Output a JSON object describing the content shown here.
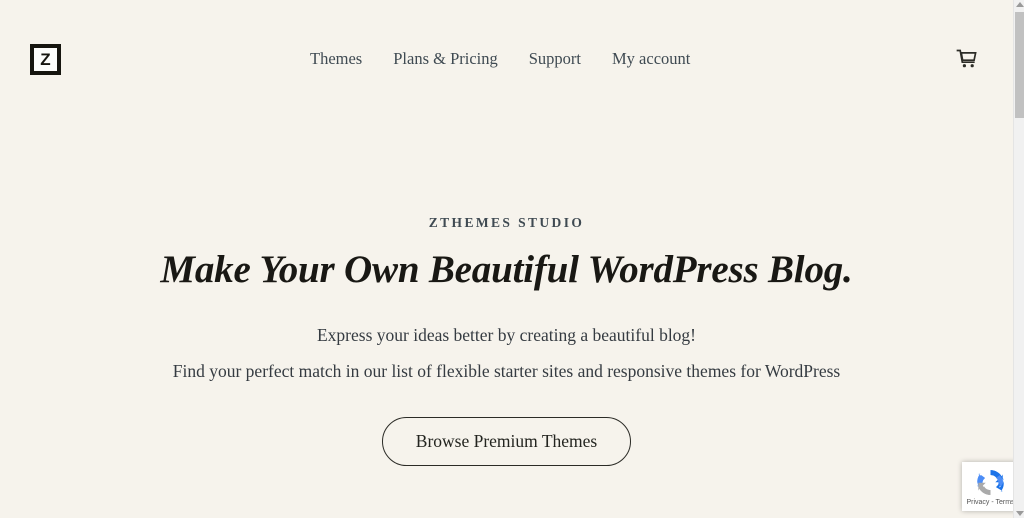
{
  "theme": {
    "background": "#f6f3ec",
    "text_dark": "#191814",
    "text_body": "#353b41",
    "nav_text": "#3f4a52",
    "border_dark": "#2b2b26"
  },
  "header": {
    "logo_letter": "Z",
    "logo_name": "ZThemes Studio logo",
    "nav": [
      {
        "label": "Themes"
      },
      {
        "label": "Plans & Pricing"
      },
      {
        "label": "Support"
      },
      {
        "label": "My account"
      }
    ],
    "cart_icon": "shopping-cart-icon"
  },
  "hero": {
    "eyebrow": "ZTHEMES STUDIO",
    "headline": "Make Your Own Beautiful WordPress Blog.",
    "subtitle_1": "Express your ideas better by creating a beautiful blog!",
    "subtitle_2": "Find your perfect match in our list of flexible starter sites and responsive themes for WordPress",
    "cta_label": "Browse Premium Themes"
  },
  "recaptcha": {
    "text": "Privacy - Terms",
    "logo_name": "recaptcha-logo"
  }
}
